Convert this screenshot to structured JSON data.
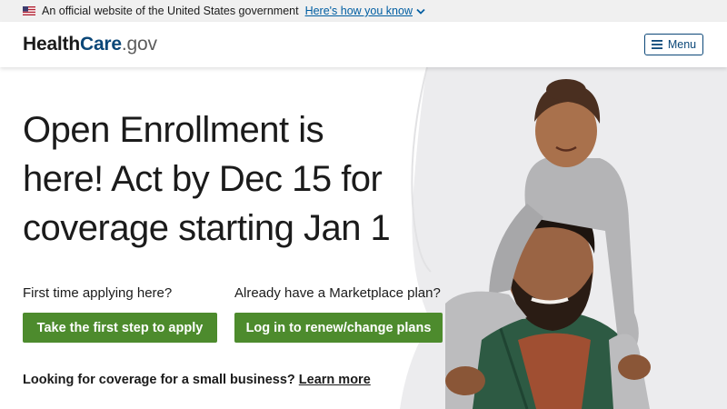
{
  "gov_banner": {
    "text": "An official website of the United States government",
    "link": "Here's how you know"
  },
  "header": {
    "logo": {
      "part1": "Health",
      "part2": "Care",
      "part3": ".gov"
    },
    "menu_label": "Menu"
  },
  "hero": {
    "headline": "Open Enrollment is here! Act by Dec 15 for coverage starting Jan 1",
    "first_time_prompt": "First time applying here?",
    "apply_button": "Take the first step to apply",
    "existing_prompt": "Already have a Marketplace plan?",
    "login_button": "Log in to renew/change plans",
    "small_business_text": "Looking for coverage for a small business?",
    "learn_more": "Learn more"
  },
  "colors": {
    "brand_blue": "#0b4778",
    "link_blue": "#005ea2",
    "button_green": "#4d8b2d",
    "banner_gray": "#f0f0f0"
  },
  "icons": [
    "us-flag-icon",
    "chevron-down-icon",
    "hamburger-menu-icon"
  ]
}
